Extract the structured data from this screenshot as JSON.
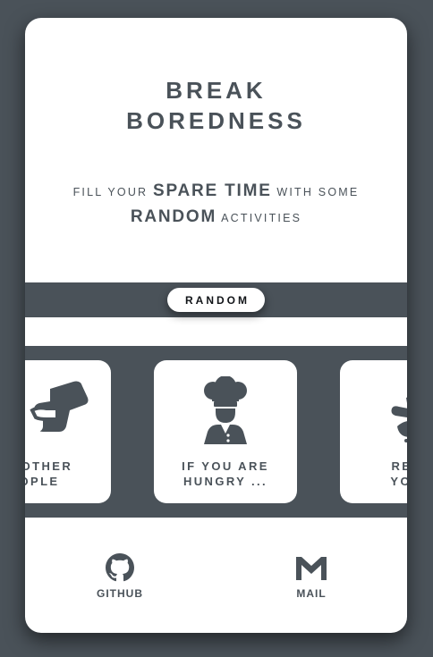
{
  "hero": {
    "title_line1": "BREAK",
    "title_line2": "BOREDNESS",
    "tagline_part1": "FILL YOUR",
    "tagline_emphasis1": "SPARE TIME",
    "tagline_part2": "WITH SOME",
    "tagline_emphasis2": "RANDOM",
    "tagline_part3": "ACTIVITIES"
  },
  "random_button": {
    "label": "RANDOM"
  },
  "categories": [
    {
      "label": "P OTHER\nOPLE",
      "icon": "handshake-icon"
    },
    {
      "label": "IF YOU ARE\nHUNGRY ...",
      "icon": "chef-icon"
    },
    {
      "label": "RELA\nYOUR",
      "icon": "yoga-icon"
    }
  ],
  "footer": {
    "github_label": "GITHUB",
    "mail_label": "MAIL"
  },
  "colors": {
    "primary": "#4a5259",
    "surface": "#ffffff",
    "text_dark": "#111418"
  }
}
